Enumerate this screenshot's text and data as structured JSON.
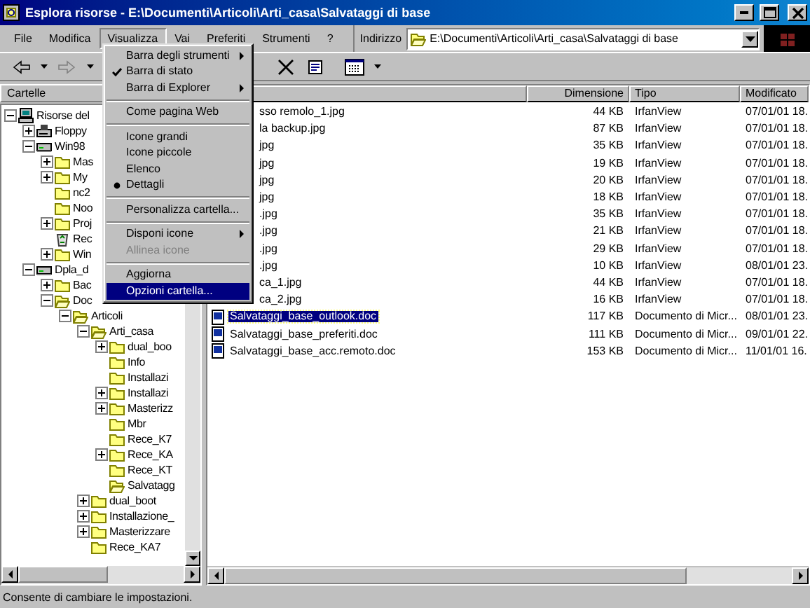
{
  "window": {
    "title": "Esplora risorse - E:\\Documenti\\Articoli\\Arti_casa\\Salvataggi di base"
  },
  "menu_bar": [
    {
      "label": "File",
      "selected": false
    },
    {
      "label": "Modifica",
      "selected": false
    },
    {
      "label": "Visualizza",
      "selected": true
    },
    {
      "label": "Vai",
      "selected": false
    },
    {
      "label": "Preferiti",
      "selected": false
    },
    {
      "label": "Strumenti",
      "selected": false
    },
    {
      "label": "?",
      "selected": false
    }
  ],
  "address_bar": {
    "label": "Indirizzo",
    "value": "E:\\Documenti\\Articoli\\Arti_casa\\Salvataggi di base"
  },
  "folder_pane": {
    "title": "Cartelle",
    "tree": [
      {
        "label": "Risorse del",
        "kind": "computer",
        "expanded": true,
        "children": [
          {
            "label": "Floppy",
            "kind": "floppy",
            "expanded": false
          },
          {
            "label": "Win98",
            "kind": "drive",
            "expanded": true,
            "children": [
              {
                "label": "Mas",
                "kind": "folder",
                "expanded": false
              },
              {
                "label": "My",
                "kind": "folder",
                "expanded": false
              },
              {
                "label": "nc2",
                "kind": "folder"
              },
              {
                "label": "Noo",
                "kind": "folder"
              },
              {
                "label": "Proj",
                "kind": "folder",
                "expanded": false
              },
              {
                "label": "Rec",
                "kind": "recycle"
              },
              {
                "label": "Win",
                "kind": "folder",
                "expanded": false
              }
            ]
          },
          {
            "label": "Dpla_d",
            "kind": "drive",
            "expanded": true,
            "children": [
              {
                "label": "Bac",
                "kind": "folder",
                "expanded": false
              },
              {
                "label": "Doc",
                "kind": "open_folder",
                "expanded": true,
                "children": [
                  {
                    "label": "Articoli",
                    "kind": "open_folder",
                    "expanded": true,
                    "children": [
                      {
                        "label": "Arti_casa",
                        "kind": "open_folder",
                        "expanded": true,
                        "children": [
                          {
                            "label": "dual_boo",
                            "kind": "folder",
                            "expanded": false
                          },
                          {
                            "label": "Info",
                            "kind": "folder"
                          },
                          {
                            "label": "Installazi",
                            "kind": "folder"
                          },
                          {
                            "label": "Installazi",
                            "kind": "folder",
                            "expanded": false
                          },
                          {
                            "label": "Masterizz",
                            "kind": "folder",
                            "expanded": false
                          },
                          {
                            "label": "Mbr",
                            "kind": "folder"
                          },
                          {
                            "label": "Rece_K7",
                            "kind": "folder"
                          },
                          {
                            "label": "Rece_KA",
                            "kind": "folder",
                            "expanded": false
                          },
                          {
                            "label": "Rece_KT",
                            "kind": "folder"
                          },
                          {
                            "label": "Salvatagg",
                            "kind": "open_folder"
                          }
                        ]
                      },
                      {
                        "label": "dual_boot",
                        "kind": "folder",
                        "expanded": false
                      },
                      {
                        "label": "Installazione_",
                        "kind": "folder",
                        "expanded": false
                      },
                      {
                        "label": "Masterizzare",
                        "kind": "folder",
                        "expanded": false
                      },
                      {
                        "label": "Rece_KA7",
                        "kind": "folder"
                      }
                    ]
                  }
                ]
              }
            ]
          }
        ]
      }
    ]
  },
  "view_menu": [
    {
      "kind": "submenu",
      "label": "Barra degli strumenti",
      "selected": false
    },
    {
      "kind": "toggle",
      "label": "Barra di stato",
      "checked": true,
      "selected": false
    },
    {
      "kind": "submenu",
      "label": "Barra di Explorer",
      "selected": false
    },
    {
      "kind": "separator"
    },
    {
      "kind": "toggle",
      "label": "Come pagina Web",
      "checked": false,
      "selected": false
    },
    {
      "kind": "separator"
    },
    {
      "kind": "radio",
      "label": "Icone grandi",
      "checked": false,
      "selected": false
    },
    {
      "kind": "radio",
      "label": "Icone piccole",
      "checked": false,
      "selected": false
    },
    {
      "kind": "radio",
      "label": "Elenco",
      "checked": false,
      "selected": false
    },
    {
      "kind": "radio",
      "label": "Dettagli",
      "checked": true,
      "selected": false
    },
    {
      "kind": "separator"
    },
    {
      "kind": "item",
      "label": "Personalizza cartella...",
      "selected": false
    },
    {
      "kind": "separator"
    },
    {
      "kind": "submenu",
      "label": "Disponi icone",
      "selected": false
    },
    {
      "kind": "item",
      "label": "Allinea icone",
      "disabled": true,
      "selected": false
    },
    {
      "kind": "separator"
    },
    {
      "kind": "item",
      "label": "Aggiorna",
      "selected": false
    },
    {
      "kind": "item",
      "label": "Opzioni cartella...",
      "selected": true
    }
  ],
  "file_list": {
    "columns": [
      "Dimensione",
      "Tipo",
      "Modificato"
    ],
    "rows": [
      {
        "name": "sso remolo_1.jpg",
        "kind": "image",
        "size": "44 KB",
        "type": "IrfanView",
        "modified": "07/01/01 18.",
        "selected": false
      },
      {
        "name": "la backup.jpg",
        "kind": "image",
        "size": "87 KB",
        "type": "IrfanView",
        "modified": "07/01/01 18.",
        "selected": false
      },
      {
        "name": "jpg",
        "kind": "image",
        "size": "35 KB",
        "type": "IrfanView",
        "modified": "07/01/01 18.",
        "selected": false
      },
      {
        "name": "jpg",
        "kind": "image",
        "size": "19 KB",
        "type": "IrfanView",
        "modified": "07/01/01 18.",
        "selected": false
      },
      {
        "name": "jpg",
        "kind": "image",
        "size": "20 KB",
        "type": "IrfanView",
        "modified": "07/01/01 18.",
        "selected": false
      },
      {
        "name": "jpg",
        "kind": "image",
        "size": "18 KB",
        "type": "IrfanView",
        "modified": "07/01/01 18.",
        "selected": false
      },
      {
        "name": ".jpg",
        "kind": "image",
        "size": "35 KB",
        "type": "IrfanView",
        "modified": "07/01/01 18.",
        "selected": false
      },
      {
        "name": ".jpg",
        "kind": "image",
        "size": "21 KB",
        "type": "IrfanView",
        "modified": "07/01/01 18.",
        "selected": false
      },
      {
        "name": ".jpg",
        "kind": "image",
        "size": "29 KB",
        "type": "IrfanView",
        "modified": "07/01/01 18.",
        "selected": false
      },
      {
        "name": ".jpg",
        "kind": "image",
        "size": "10 KB",
        "type": "IrfanView",
        "modified": "08/01/01 23.",
        "selected": false
      },
      {
        "name": "ca_1.jpg",
        "kind": "image",
        "size": "44 KB",
        "type": "IrfanView",
        "modified": "07/01/01 18.",
        "selected": false
      },
      {
        "name": "ca_2.jpg",
        "kind": "image",
        "size": "16 KB",
        "type": "IrfanView",
        "modified": "07/01/01 18.",
        "selected": false
      },
      {
        "name": "Salvataggi_base_outlook.doc",
        "kind": "document",
        "size": "117 KB",
        "type": "Documento di Micr...",
        "modified": "08/01/01 23.",
        "selected": true
      },
      {
        "name": "Salvataggi_base_preferiti.doc",
        "kind": "document",
        "size": "111 KB",
        "type": "Documento di Micr...",
        "modified": "09/01/01 22.",
        "selected": false
      },
      {
        "name": "Salvataggi_base_acc.remoto.doc",
        "kind": "document",
        "size": "153 KB",
        "type": "Documento di Micr...",
        "modified": "11/01/01 16.",
        "selected": false
      }
    ]
  },
  "status_bar": {
    "text": "Consente di cambiare le impostazioni."
  }
}
